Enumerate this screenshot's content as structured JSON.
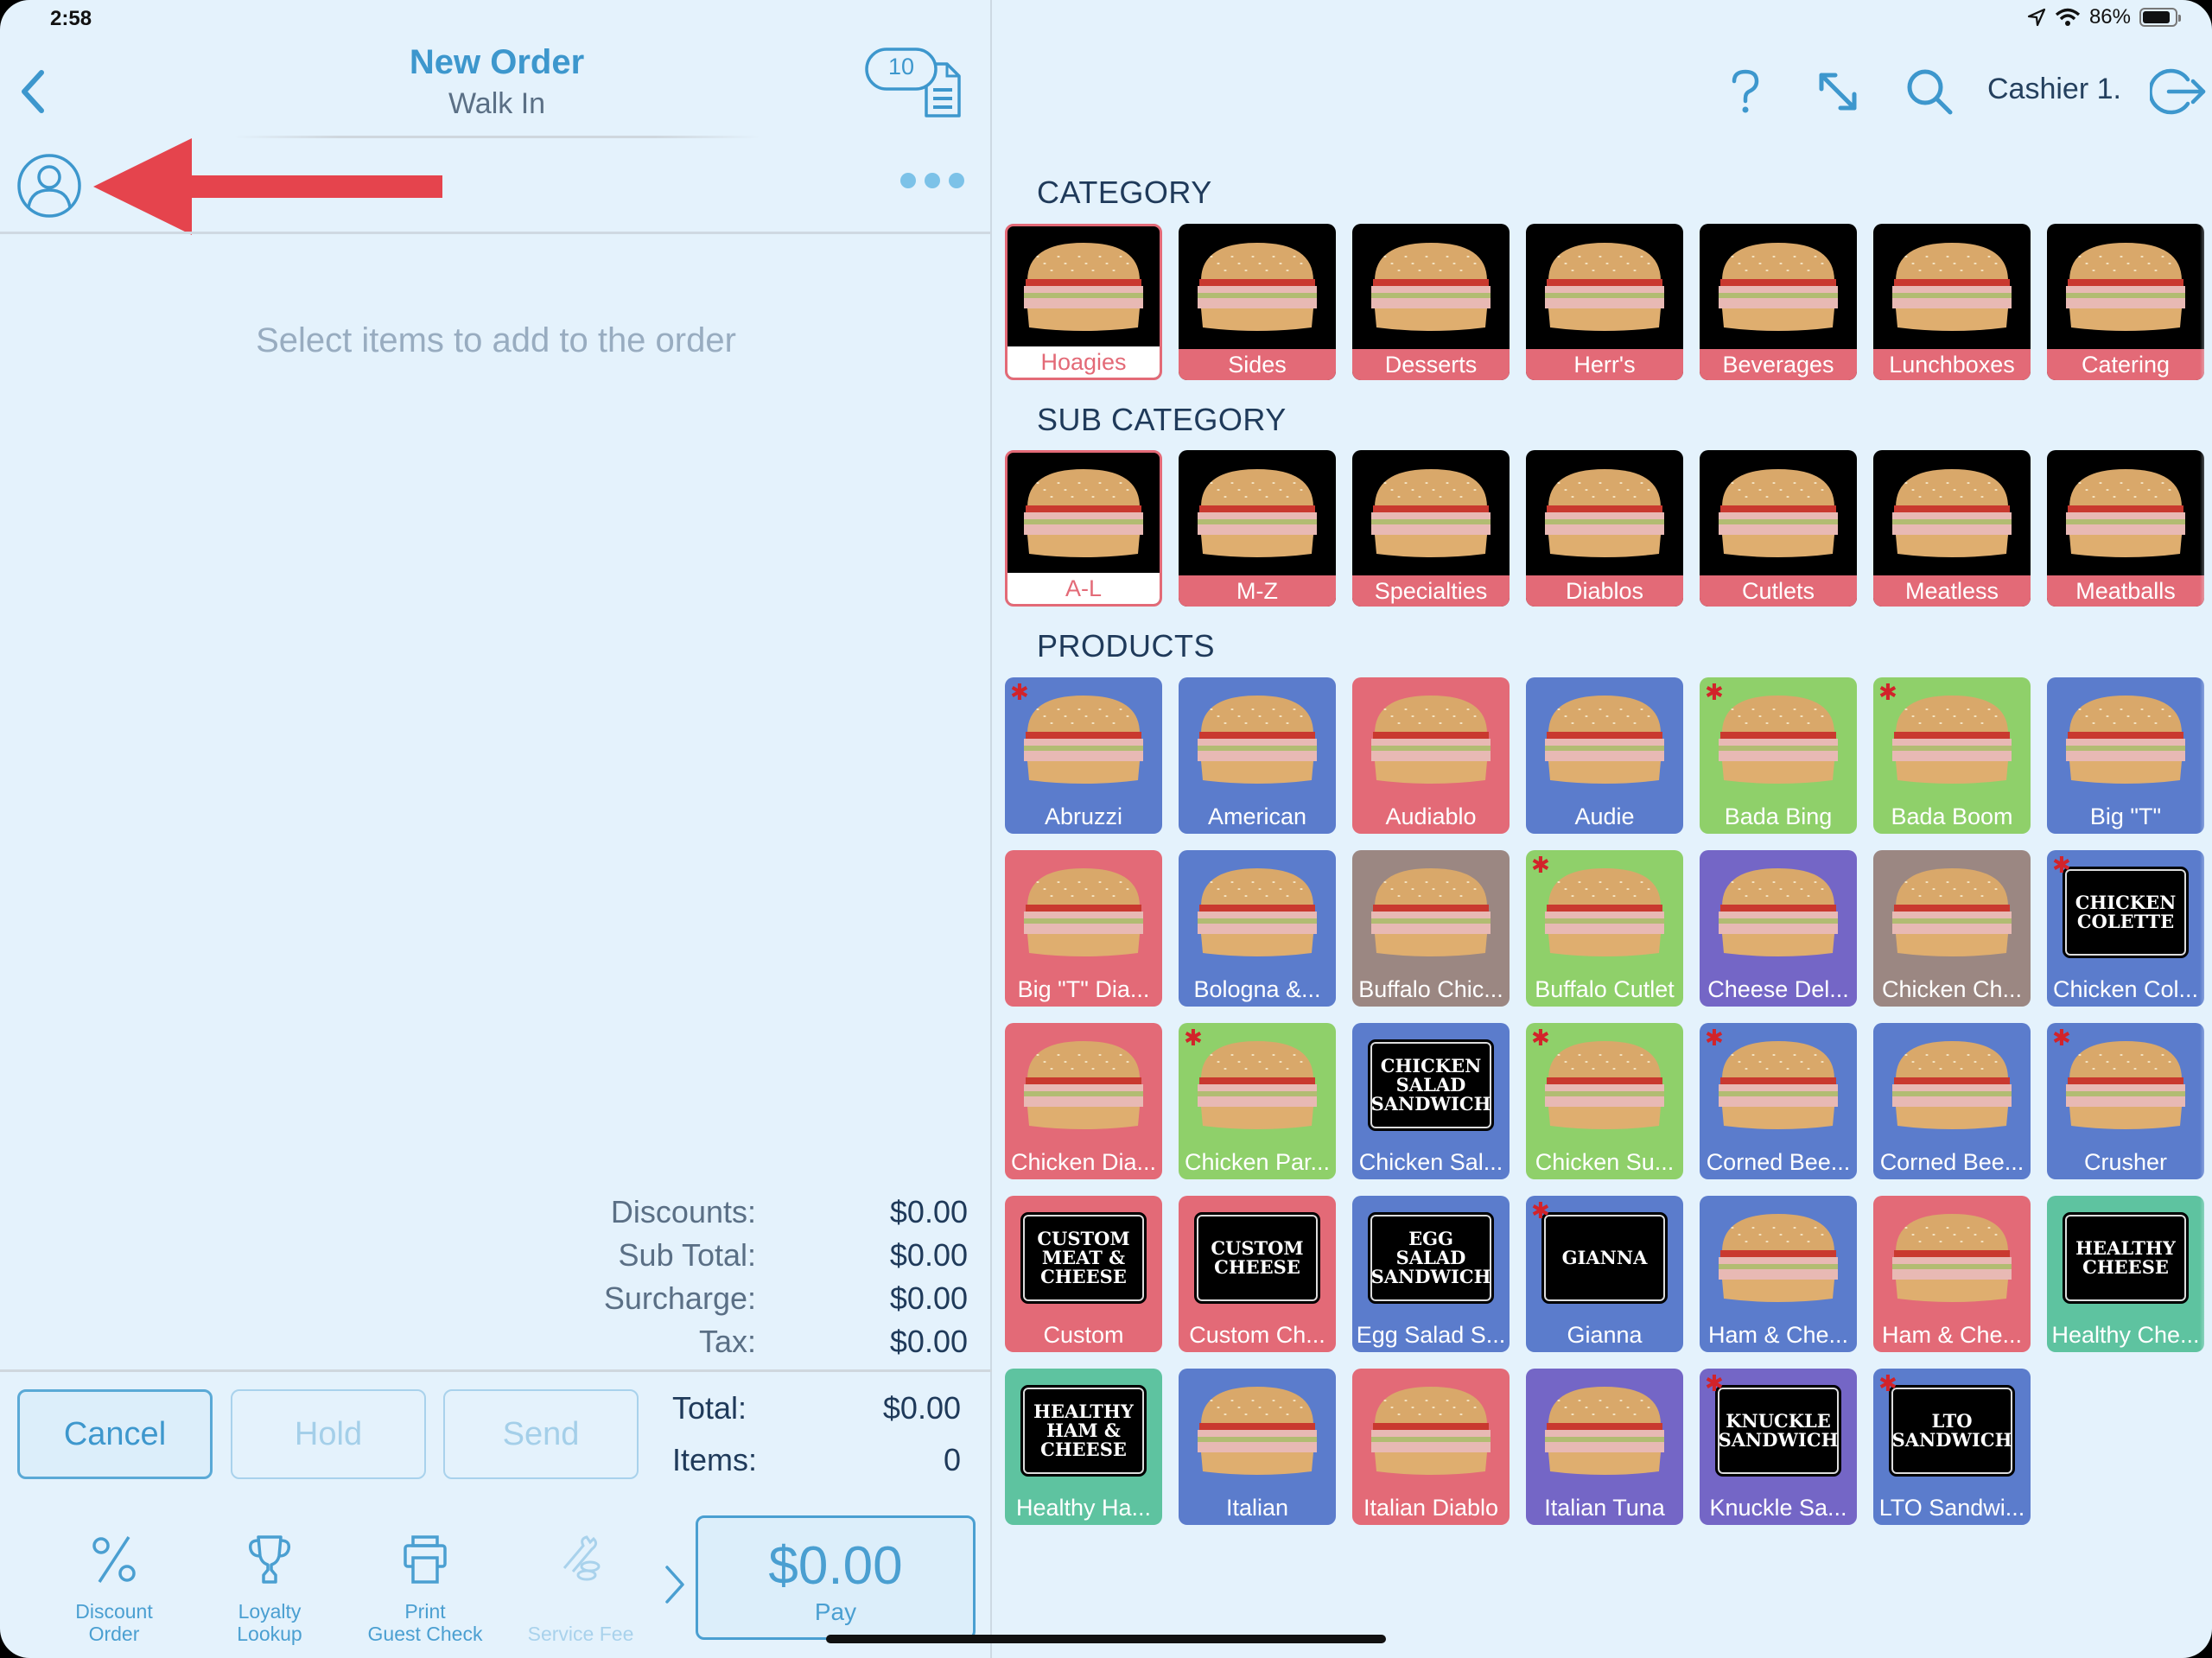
{
  "status_bar": {
    "time": "2:58",
    "battery": "86%",
    "battery_level": 0.86
  },
  "header": {
    "title": "New Order",
    "subtitle": "Walk In",
    "open_orders_count": "10",
    "cashier": "Cashier 1.",
    "icons": [
      "back-chevron-icon",
      "orders-list-icon",
      "help-icon",
      "expand-icon",
      "search-icon",
      "logout-icon"
    ]
  },
  "order": {
    "empty_message": "Select items to add to the order",
    "totals": [
      {
        "label": "Discounts:",
        "value": "$0.00"
      },
      {
        "label": "Sub Total:",
        "value": "$0.00"
      },
      {
        "label": "Surcharge:",
        "value": "$0.00"
      },
      {
        "label": "Tax:",
        "value": "$0.00"
      }
    ],
    "total_label": "Total:",
    "total_value": "$0.00",
    "items_label": "Items:",
    "items_value": "0",
    "buttons": {
      "cancel": "Cancel",
      "hold": "Hold",
      "send": "Send"
    },
    "footer": [
      {
        "label": "Discount\nOrder",
        "icon": "percent-icon",
        "enabled": true
      },
      {
        "label": "Loyalty\nLookup",
        "icon": "trophy-icon",
        "enabled": true
      },
      {
        "label": "Print\nGuest Check",
        "icon": "printer-icon",
        "enabled": true
      },
      {
        "label": "Service Fee",
        "icon": "service-fee-icon",
        "enabled": false
      }
    ],
    "pay_amount": "$0.00",
    "pay_label": "Pay"
  },
  "menu": {
    "category_title": "CATEGORY",
    "subcategory_title": "SUB CATEGORY",
    "products_title": "PRODUCTS",
    "categories": [
      {
        "label": "Hoagies",
        "selected": true
      },
      {
        "label": "Sides",
        "selected": false
      },
      {
        "label": "Desserts",
        "selected": false
      },
      {
        "label": "Herr's",
        "selected": false
      },
      {
        "label": "Beverages",
        "selected": false
      },
      {
        "label": "Lunchboxes",
        "selected": false
      },
      {
        "label": "Catering",
        "selected": false
      }
    ],
    "subcategories": [
      {
        "label": "A-L",
        "selected": true
      },
      {
        "label": "M-Z",
        "selected": false
      },
      {
        "label": "Specialties",
        "selected": false
      },
      {
        "label": "Diablos",
        "selected": false
      },
      {
        "label": "Cutlets",
        "selected": false
      },
      {
        "label": "Meatless",
        "selected": false
      },
      {
        "label": "Meatballs",
        "selected": false
      }
    ],
    "products": [
      {
        "label": "Abruzzi",
        "color": "#5b7ccc",
        "star": true
      },
      {
        "label": "American",
        "color": "#5b7ccc",
        "star": false
      },
      {
        "label": "Audiablo",
        "color": "#e36a77",
        "star": false
      },
      {
        "label": "Audie",
        "color": "#5b7ccc",
        "star": false
      },
      {
        "label": "Bada Bing",
        "color": "#8fd06a",
        "star": true
      },
      {
        "label": "Bada Boom",
        "color": "#8fd06a",
        "star": true
      },
      {
        "label": "Big \"T\"",
        "color": "#5b7ccc",
        "star": false
      },
      {
        "label": "Big \"T\" Dia...",
        "color": "#e36a77",
        "star": false
      },
      {
        "label": "Bologna &...",
        "color": "#5b7ccc",
        "star": false
      },
      {
        "label": "Buffalo Chic...",
        "color": "#9b8782",
        "star": false
      },
      {
        "label": "Buffalo Cutlet",
        "color": "#8fd06a",
        "star": true
      },
      {
        "label": "Cheese Del...",
        "color": "#7466c6",
        "star": false
      },
      {
        "label": "Chicken Ch...",
        "color": "#9b8782",
        "star": false
      },
      {
        "label": "Chicken Col...",
        "color": "#5b7ccc",
        "star": true,
        "sign": "CHICKEN\nCOLETTE"
      },
      {
        "label": "Chicken Dia...",
        "color": "#e36a77",
        "star": false
      },
      {
        "label": "Chicken Par...",
        "color": "#8fd06a",
        "star": true
      },
      {
        "label": "Chicken Sal...",
        "color": "#5b7ccc",
        "star": false,
        "sign": "CHICKEN\nSALAD\nSANDWICH"
      },
      {
        "label": "Chicken Su...",
        "color": "#8fd06a",
        "star": true
      },
      {
        "label": "Corned Bee...",
        "color": "#5b7ccc",
        "star": true
      },
      {
        "label": "Corned Bee...",
        "color": "#5b7ccc",
        "star": false
      },
      {
        "label": "Crusher",
        "color": "#5b7ccc",
        "star": true
      },
      {
        "label": "Custom",
        "color": "#e36a77",
        "star": false,
        "sign": "CUSTOM\nMEAT &\nCHEESE"
      },
      {
        "label": "Custom Ch...",
        "color": "#e36a77",
        "star": false,
        "sign": "CUSTOM\nCHEESE"
      },
      {
        "label": "Egg Salad S...",
        "color": "#5b7ccc",
        "star": false,
        "sign": "EGG SALAD\nSANDWICH"
      },
      {
        "label": "Gianna",
        "color": "#5b7ccc",
        "star": true,
        "sign": "GIANNA"
      },
      {
        "label": "Ham & Che...",
        "color": "#5b7ccc",
        "star": false
      },
      {
        "label": "Ham & Che...",
        "color": "#e36a77",
        "star": false
      },
      {
        "label": "Healthy Che...",
        "color": "#5ec3a0",
        "star": false,
        "sign": "HEALTHY\nCHEESE"
      },
      {
        "label": "Healthy Ha...",
        "color": "#5ec3a0",
        "star": false,
        "sign": "HEALTHY\nHAM &\nCHEESE"
      },
      {
        "label": "Italian",
        "color": "#5b7ccc",
        "star": false
      },
      {
        "label": "Italian Diablo",
        "color": "#e36a77",
        "star": false
      },
      {
        "label": "Italian Tuna",
        "color": "#7466c6",
        "star": false
      },
      {
        "label": "Knuckle Sa...",
        "color": "#7466c6",
        "star": true,
        "sign": "KNUCKLE\nSANDWICH"
      },
      {
        "label": "LTO Sandwi...",
        "color": "#5b7ccc",
        "star": true,
        "sign": "LTO\nSANDWICH"
      }
    ]
  },
  "colors": {
    "accent": "#3d97cd",
    "tile_label": "#e36a77",
    "background": "#e4f2fc",
    "annotation_arrow": "#e5444d"
  }
}
